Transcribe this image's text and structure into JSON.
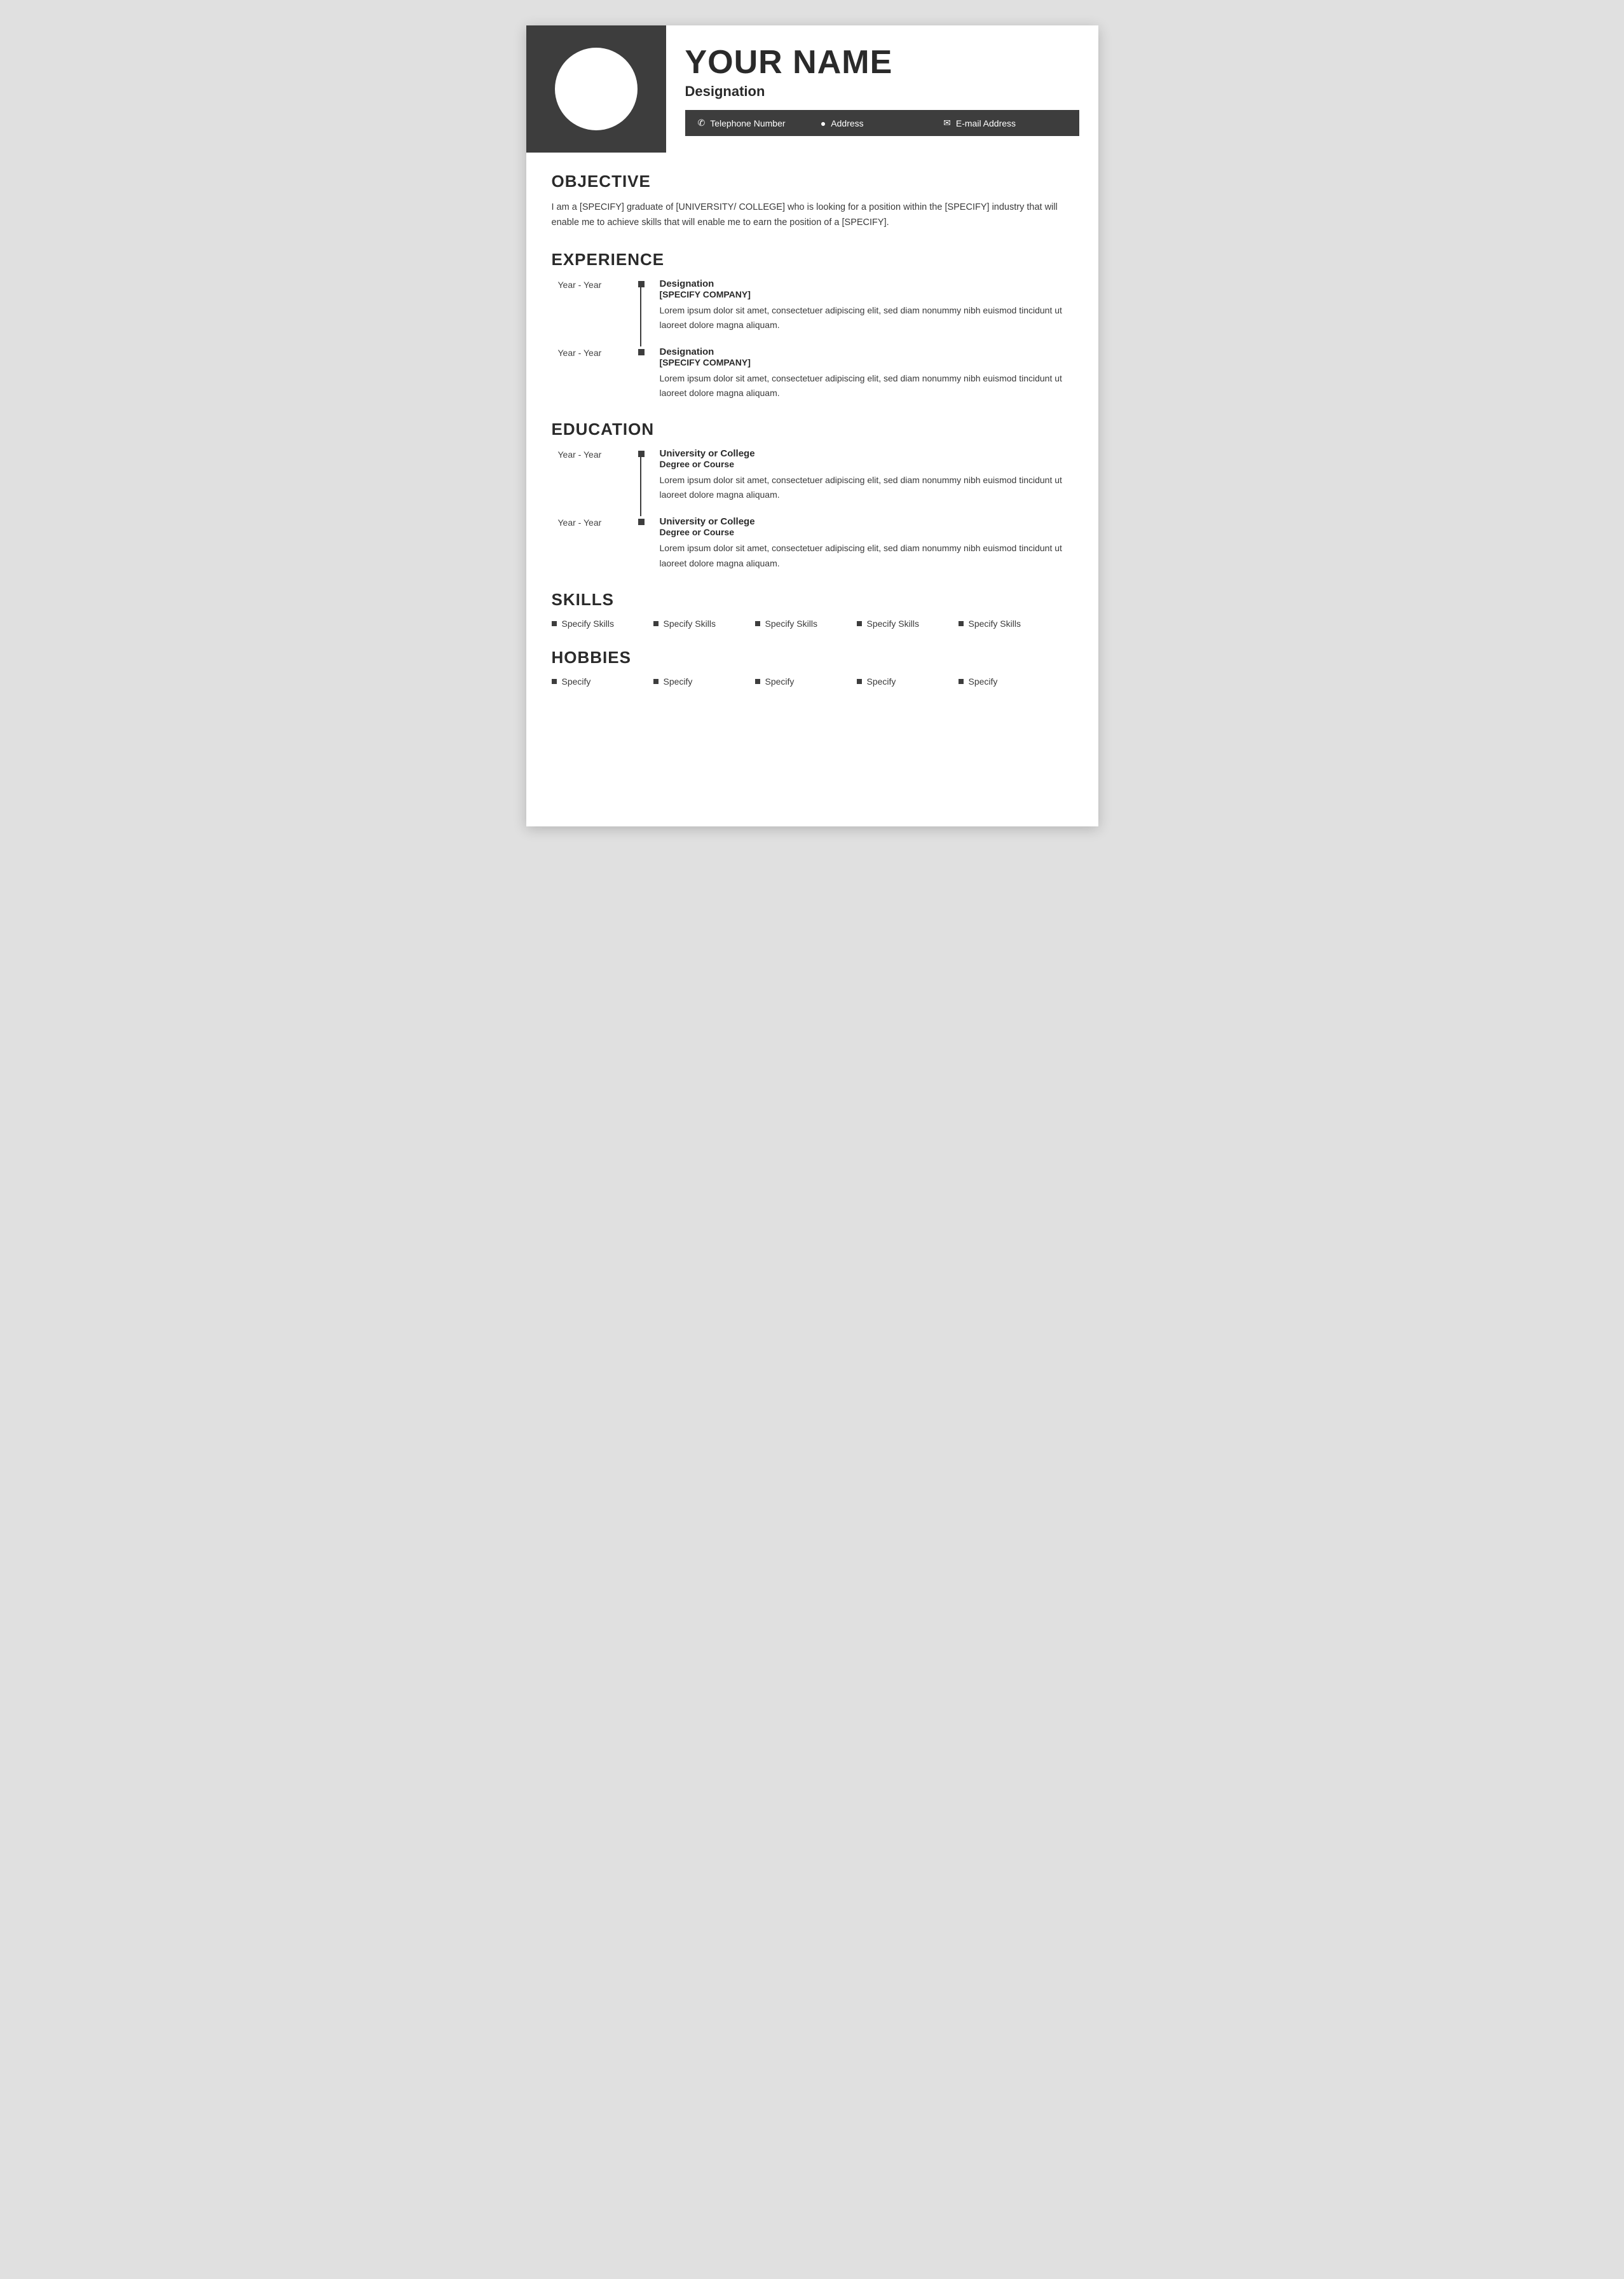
{
  "header": {
    "name": "YOUR NAME",
    "designation": "Designation",
    "contact": {
      "phone": "Telephone Number",
      "address": "Address",
      "email": "E-mail Address"
    }
  },
  "objective": {
    "title": "OBJECTIVE",
    "text": "I am a [SPECIFY] graduate of [UNIVERSITY/ COLLEGE] who is looking for a position within the [SPECIFY] industry that will enable me to achieve skills that will enable me to earn the position of a [SPECIFY]."
  },
  "experience": {
    "title": "EXPERIENCE",
    "items": [
      {
        "years": "Year - Year",
        "role": "Designation",
        "company": "[SPECIFY COMPANY]",
        "desc": "Lorem ipsum dolor sit amet, consectetuer adipiscing elit, sed diam nonummy nibh euismod tincidunt ut laoreet dolore magna aliquam."
      },
      {
        "years": "Year - Year",
        "role": "Designation",
        "company": "[SPECIFY COMPANY]",
        "desc": "Lorem ipsum dolor sit amet, consectetuer adipiscing elit, sed diam nonummy nibh euismod tincidunt ut laoreet dolore magna aliquam."
      }
    ]
  },
  "education": {
    "title": "EDUCATION",
    "items": [
      {
        "years": "Year - Year",
        "school": "University or College",
        "degree": "Degree or Course",
        "desc": "Lorem ipsum dolor sit amet, consectetuer adipiscing elit, sed diam nonummy nibh euismod tincidunt ut laoreet dolore magna aliquam."
      },
      {
        "years": "Year - Year",
        "school": "University or College",
        "degree": "Degree or Course",
        "desc": "Lorem ipsum dolor sit amet, consectetuer adipiscing elit, sed diam nonummy nibh euismod tincidunt ut laoreet dolore magna aliquam."
      }
    ]
  },
  "skills": {
    "title": "SKILLS",
    "items": [
      "Specify Skills",
      "Specify Skills",
      "Specify Skills",
      "Specify Skills",
      "Specify Skills"
    ]
  },
  "hobbies": {
    "title": "HOBBIES",
    "items": [
      "Specify",
      "Specify",
      "Specify",
      "Specify",
      "Specify"
    ]
  },
  "colors": {
    "dark": "#3d3d3d",
    "text": "#2a2a2a",
    "white": "#ffffff"
  }
}
